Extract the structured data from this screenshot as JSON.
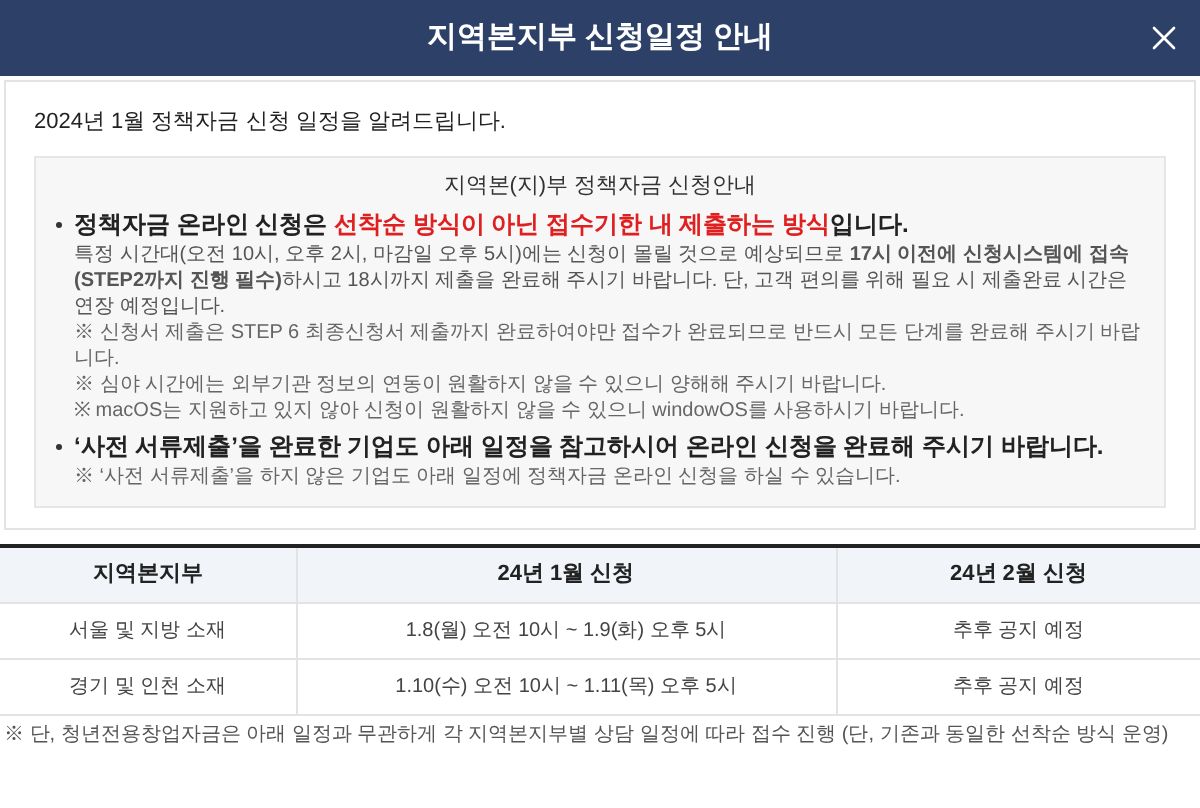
{
  "window": {
    "title": "지역본지부 신청일정 안내"
  },
  "intro": "2024년 1월 정책자금 신청 일정을 알려드립니다.",
  "notice": {
    "title": "지역본(지)부 정책자금 신청안내",
    "items": [
      {
        "kind": "bullet",
        "parts": [
          {
            "text": "정책자금 온라인 신청은 ",
            "highlight": false
          },
          {
            "text": "선착순 방식이 아닌 접수기한 내 제출하는 방식",
            "highlight": true
          },
          {
            "text": "입니다.",
            "highlight": false
          }
        ]
      },
      {
        "kind": "paragraph",
        "text": "특정 시간대(오전 10시, 오후 2시, 마감일 오후 5시)에는 신청이 몰릴 것으로 예상되므로 **17시 이전에 신청시스템에 접속(STEP2까지 진행 필수)**하시고 18시까지 제출을 완료해 주시기 바랍니다. 단, 고객 편의를 위해 필요 시 제출완료 시간은 연장 예정입니다."
      },
      {
        "kind": "note",
        "text": "※ 신청서 제출은 STEP 6 최종신청서 제출까지 완료하여야만 접수가 완료되므로 반드시 모든 단계를 완료해 주시기 바랍니다."
      },
      {
        "kind": "note",
        "text": "※ 심야 시간에는 외부기관 정보의 연동이 원활하지 않을 수 있으니 양해해 주시기 바랍니다."
      },
      {
        "kind": "note",
        "text": "※ macOS는 지원하고 있지 않아 신청이 원활하지 않을 수 있으니 windowOS를 사용하시기 바랍니다."
      },
      {
        "kind": "bullet",
        "parts": [
          {
            "text": "‘사전 서류제출’을 완료한 기업도 아래 일정을 참고하시어 온라인 신청을 완료해 주시기 바랍니다.",
            "highlight": false
          }
        ]
      },
      {
        "kind": "note",
        "text": "※ ‘사전 서류제출’을 하지 않은 기업도 아래 일정에 정책자금 온라인 신청을 하실 수 있습니다."
      }
    ]
  },
  "table": {
    "columns": [
      "지역본지부",
      "24년 1월 신청",
      "24년 2월 신청"
    ],
    "rows": [
      [
        "서울 및 지방 소재",
        "1.8(월) 오전 10시 ~ 1.9(화) 오후 5시",
        "추후 공지 예정"
      ],
      [
        "경기 및 인천 소재",
        "1.10(수) 오전 10시 ~ 1.11(목) 오후 5시",
        "추후 공지 예정"
      ]
    ]
  },
  "footnote": "※ 단, 청년전용창업자금은 아래 일정과 무관하게 각 지역본지부별 상담 일정에 따라 접수 진행 (단, 기존과 동일한 선착순 방식 운영)"
}
